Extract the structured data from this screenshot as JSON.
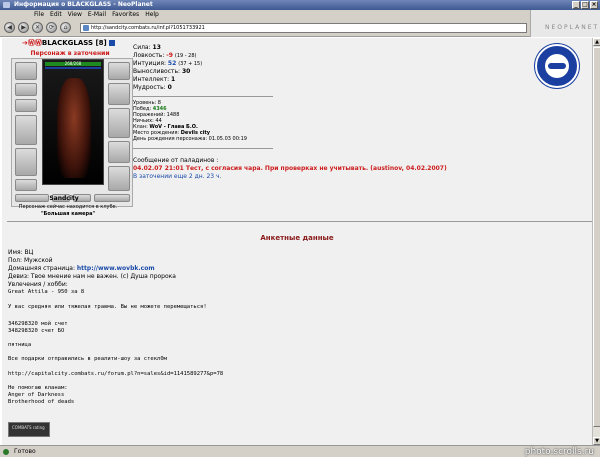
{
  "window": {
    "title": "Информация о BLACKGLASS - NeoPlanet"
  },
  "menu": {
    "items": [
      "File",
      "Edit",
      "View",
      "E-Mail",
      "Favorites",
      "Help"
    ]
  },
  "brand": {
    "logo": "NEOPLANET"
  },
  "toolbar": {
    "address": "http://sandcity.combats.ru/inf.pl?1051733921",
    "nav": [
      "◀",
      "▶",
      "✕",
      "⟳",
      "⌂"
    ]
  },
  "character": {
    "name": "BLACKGLASS",
    "level": "[8]",
    "prison_label": "Персонаж в заточении",
    "hp": "268/268",
    "city": "Sandcity",
    "note_line1": "Персонаж сейчас находится в клубе.",
    "note_line2": "\"Большая камера\""
  },
  "stats": {
    "strength_label": "Сила:",
    "strength": "13",
    "agility_label": "Ловкость:",
    "agility": "-9",
    "agility_extra": "(19 - 28)",
    "intuition_label": "Интуиция:",
    "intuition": "52",
    "intuition_extra": "(37 + 15)",
    "endurance_label": "Выносливость:",
    "endurance": "30",
    "intellect_label": "Интеллект:",
    "intellect": "1",
    "wisdom_label": "Мудрость:",
    "wisdom": "0"
  },
  "info": {
    "level": "Уровень: 8",
    "wins_label": "Побед:",
    "wins": "4346",
    "losses": "Поражений: 1488",
    "draws": "Ничьих: 44",
    "clan_label": "Клан:",
    "clan": "WoV - Глава Б.О.",
    "birthplace_label": "Место рождения:",
    "birthplace": "Devils city",
    "birthday": "День рождения персонажа: 01.05.03 00:19"
  },
  "message": {
    "header": "Сообщение от паладинов :",
    "text": "04.02.07 21:01 Тест, с согласия чара. При проверках не учитывать. (austinov, 04.02.2007)",
    "prison_time": "В заточении еще 2 дн. 23 ч."
  },
  "profile": {
    "section_title": "Анкетные данные",
    "name": "Имя: ВЦ",
    "gender": "Пол: Мужской",
    "homepage_label": "Домашняя страница:",
    "homepage": "http://www.wovbk.com",
    "motto": "Девиз: Твое мнение нам не важен. (с) Душа пророка",
    "hobby_label": "Увлечения / хобби:",
    "hobby_lines": [
      "Great Attila - 950 за 8",
      "",
      "У вас средняя или тяжелая травма. Вы не можете перемещаться!",
      "",
      "346298320 мой счет",
      "348298320 счет БО",
      "",
      "пятница",
      "",
      "Все подарки отправились в реалити-шоу за стекл0м",
      "",
      "http://capitalcity.combats.ru/forum.pl?n=sales&id=1141589277&p=78",
      "",
      "Не помогаю кланам:",
      "Anger of Darkness",
      "Brotherhood of deads"
    ]
  },
  "status": {
    "text": "Готово",
    "watermark": "photo.scrolls.ru"
  },
  "counter": {
    "text": "COMBATS\nrating"
  },
  "colors": {
    "accent": "#cc1a1a",
    "link": "#1a4aa8",
    "badge": "#1a3fa0"
  }
}
